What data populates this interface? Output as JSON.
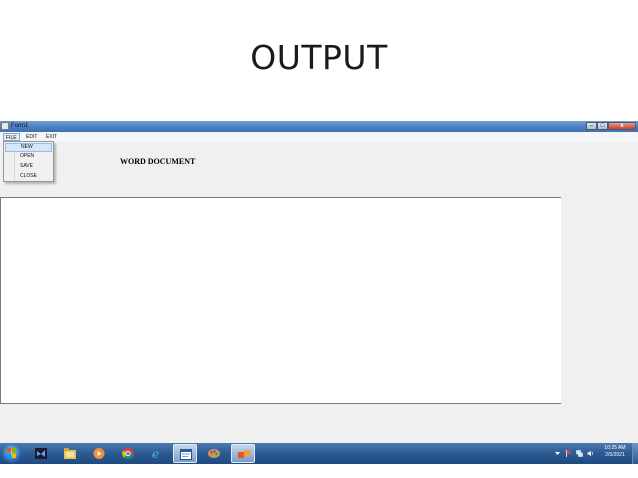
{
  "slide": {
    "title": "OUTPUT"
  },
  "window": {
    "title": "Form1",
    "controls": {
      "minimize": "–",
      "maximize": "□",
      "close": "x"
    },
    "menu": [
      {
        "label": "FILE",
        "open": true
      },
      {
        "label": "EDIT"
      },
      {
        "label": "EXIT"
      }
    ],
    "file_menu_items": [
      {
        "label": "NEW",
        "highlighted": true
      },
      {
        "label": "OPEN"
      },
      {
        "label": "SAVE"
      },
      {
        "label": "CLOSE"
      }
    ],
    "label": "WORD DOCUMENT",
    "textbox_value": ""
  },
  "taskbar": {
    "pinned": [
      {
        "name": "visual-studio-icon",
        "active": false
      },
      {
        "name": "explorer-icon",
        "active": false
      },
      {
        "name": "media-player-icon",
        "active": false
      },
      {
        "name": "chrome-icon",
        "active": false
      },
      {
        "name": "internet-explorer-icon",
        "active": false
      },
      {
        "name": "form-app-icon",
        "active": true
      },
      {
        "name": "paint-icon",
        "active": false
      },
      {
        "name": "office-icon",
        "active": true
      }
    ],
    "time": "10:25 AM",
    "date": "2/5/2021"
  },
  "colors": {
    "titlebar": "#4b7fbf",
    "taskbar": "#2b5a93",
    "window_bg": "#f0f0f0",
    "menu_highlight": "#d5e6fa"
  }
}
